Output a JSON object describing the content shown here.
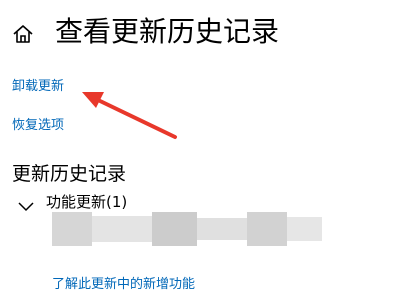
{
  "header": {
    "home_icon": "home-icon",
    "title": "查看更新历史记录"
  },
  "links": {
    "uninstall": "卸载更新",
    "recovery": "恢复选项"
  },
  "history": {
    "heading": "更新历史记录",
    "groups": [
      {
        "label": "功能更新(1)",
        "expanded": true,
        "icon": "chevron-down-icon",
        "learn_more": "了解此更新中的新增功能"
      }
    ]
  },
  "annotation": {
    "color": "#e8382b",
    "target": "卸载更新"
  },
  "colors": {
    "link": "#0067b8",
    "text": "#000000",
    "background": "#ffffff"
  }
}
